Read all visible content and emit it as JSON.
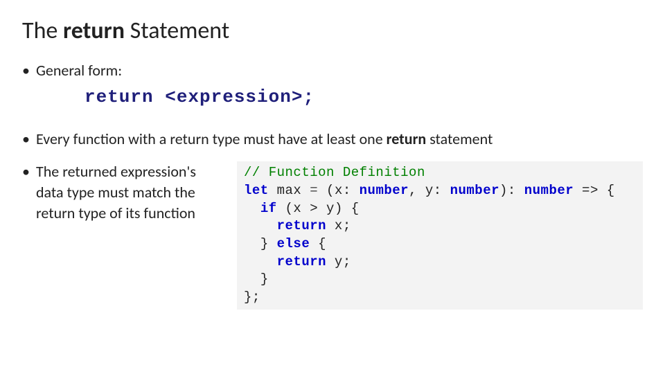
{
  "title": {
    "pre": "The ",
    "kw": "return",
    "post": " Statement"
  },
  "bullet1": "General form:",
  "syntax": "return <expression>;",
  "bullet2": {
    "pre": "Every function with a return type must have at least one ",
    "kw": "return",
    "post": " statement"
  },
  "bullet3": "The returned expression's data type must match the return type of its function",
  "code": {
    "l1": "// Function Definition",
    "l2_let": "let",
    "l2_name": " max ",
    "l2_eq": "=",
    "l2_paren_open": " (x: ",
    "l2_num1": "number",
    "l2_comma": ", y: ",
    "l2_num2": "number",
    "l2_close": "): ",
    "l2_num3": "number",
    "l2_arrow": " => {",
    "l3_if": "if",
    "l3_cond": " (x > y) {",
    "l4_return": "return",
    "l4_x": " x;",
    "l5_else_open": "} ",
    "l5_else": "else",
    "l5_else_close": " {",
    "l6_return": "return",
    "l6_y": " y;",
    "l7": "}",
    "l8": "};"
  }
}
